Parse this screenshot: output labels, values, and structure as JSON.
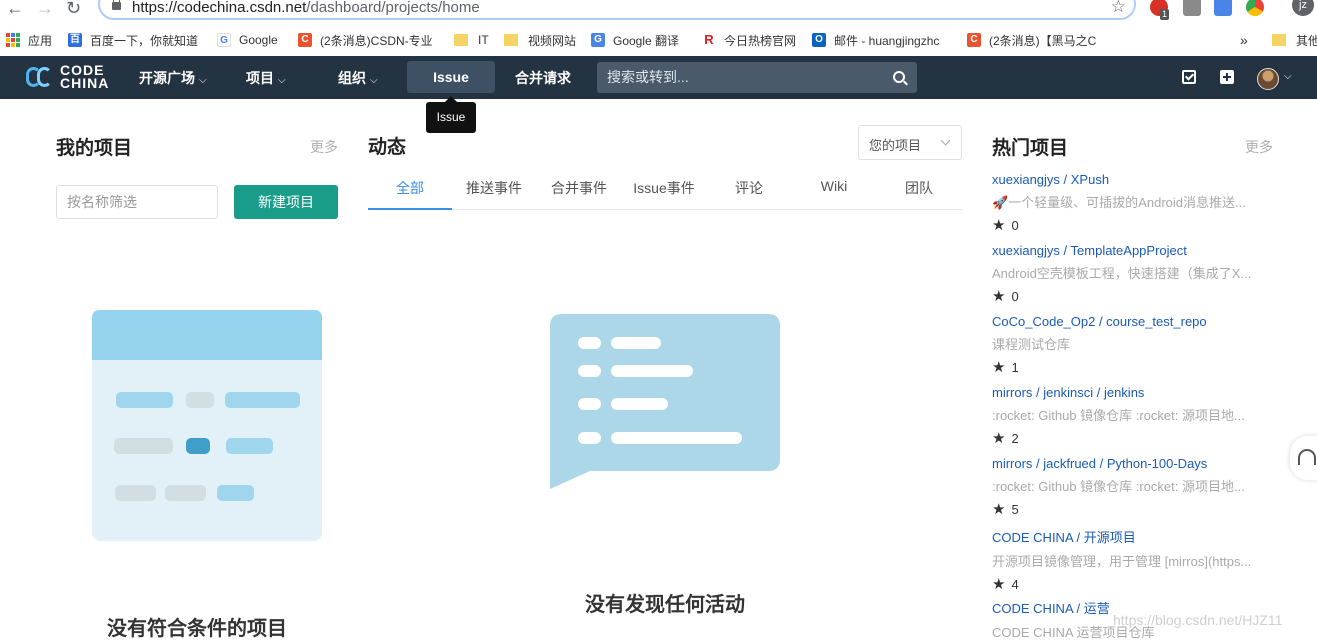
{
  "browser": {
    "url_main": "https://codechina.csdn.net",
    "url_path": "/dashboard/projects/home",
    "badge": "1",
    "profile": "jz",
    "bookmarks": [
      {
        "label": "应用",
        "icon": "apps-icon"
      },
      {
        "label": "百度一下，你就知道",
        "icon": "baidu-icon"
      },
      {
        "label": "Google",
        "icon": "google-icon"
      },
      {
        "label": "(2条消息)CSDN-专业",
        "icon": "csdn-icon"
      },
      {
        "label": "IT",
        "icon": "folder-icon"
      },
      {
        "label": "视频网站",
        "icon": "folder-icon"
      },
      {
        "label": "Google 翻译",
        "icon": "translate-icon"
      },
      {
        "label": "今日热榜官网",
        "icon": "rebang-icon"
      },
      {
        "label": "邮件 - huangjingzhc",
        "icon": "outlook-icon"
      },
      {
        "label": "(2条消息)【黑马之C",
        "icon": "csdn-icon"
      },
      {
        "label": "»",
        "icon": "overflow-icon"
      },
      {
        "label": "其他",
        "icon": "folder-icon"
      }
    ]
  },
  "nav": {
    "logo_line1": "CODE",
    "logo_line2": "CHINA",
    "items": [
      "开源广场",
      "项目",
      "组织"
    ],
    "active": "Issue",
    "merge": "合并请求",
    "search_placeholder": "搜索或转到...",
    "tooltip": "Issue"
  },
  "left": {
    "title": "我的项目",
    "more": "更多",
    "filter_placeholder": "按名称筛选",
    "new_button": "新建项目",
    "empty_text": "没有符合条件的项目"
  },
  "center": {
    "title": "动态",
    "select_value": "您的项目",
    "tabs": [
      "全部",
      "推送事件",
      "合并事件",
      "Issue事件",
      "评论",
      "Wiki",
      "团队"
    ],
    "empty_text": "没有发现任何活动"
  },
  "right": {
    "title": "热门项目",
    "more": "更多",
    "projects": [
      {
        "name": "xuexiangjys / XPush",
        "desc": "🚀一个轻量级、可插拔的Android消息推送...",
        "stars": "0"
      },
      {
        "name": "xuexiangjys / TemplateAppProject",
        "desc": "Android空壳模板工程，快速搭建（集成了X...",
        "stars": "0"
      },
      {
        "name": "CoCo_Code_Op2 / course_test_repo",
        "desc": "课程测试仓库",
        "stars": "1"
      },
      {
        "name": "mirrors / jenkinsci / jenkins",
        "desc": ":rocket: Github 镜像仓库 :rocket: 源项目地...",
        "stars": "2"
      },
      {
        "name": "mirrors / jackfrued / Python-100-Days",
        "desc": ":rocket: Github 镜像仓库 :rocket: 源项目地...",
        "stars": "5"
      },
      {
        "name": "CODE CHINA / 开源项目",
        "desc": "开源项目镜像管理，用于管理 [mirros](https...",
        "stars": "4"
      },
      {
        "name": "CODE CHINA / 运营",
        "desc": "CODE CHINA 运营项目仓库",
        "stars": ""
      }
    ],
    "watermark": "https://blog.csdn.net/HJZ11"
  },
  "colors": {
    "navbar": "#243341",
    "primary_button": "#1a9c8b",
    "tab_active": "#3a8ee6",
    "link": "#1a5bb8"
  }
}
